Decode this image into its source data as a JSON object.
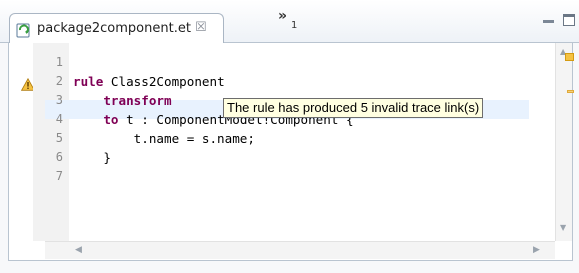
{
  "tab": {
    "title": "package2component.et",
    "close_glyph": "☒",
    "icon": "script-file-icon"
  },
  "overflow": {
    "chevron": "»",
    "count": "1"
  },
  "editor": {
    "lines": [
      {
        "num": "1",
        "tokens": []
      },
      {
        "num": "2",
        "tokens": [
          {
            "t": "kw",
            "v": "rule"
          },
          {
            "t": "txt",
            "v": " Class2Component"
          }
        ]
      },
      {
        "num": "3",
        "tokens": [
          {
            "t": "txt",
            "v": "    "
          },
          {
            "t": "kw",
            "v": "transform"
          }
        ]
      },
      {
        "num": "4",
        "tokens": [
          {
            "t": "txt",
            "v": "    "
          },
          {
            "t": "kw",
            "v": "to"
          },
          {
            "t": "txt",
            "v": " t : ComponentModel!Component {"
          }
        ]
      },
      {
        "num": "5",
        "tokens": [
          {
            "t": "txt",
            "v": "        t.name = s.name;"
          }
        ]
      },
      {
        "num": "6",
        "tokens": [
          {
            "t": "txt",
            "v": "    }"
          }
        ]
      },
      {
        "num": "7",
        "tokens": []
      }
    ],
    "warning_line": "2",
    "tooltip": "The rule has produced 5 invalid trace link(s)"
  },
  "colors": {
    "keyword": "#7f0055",
    "tooltip_bg": "#ffffe1",
    "current_line": "#e8f2fe",
    "warning": "#f5c242"
  }
}
